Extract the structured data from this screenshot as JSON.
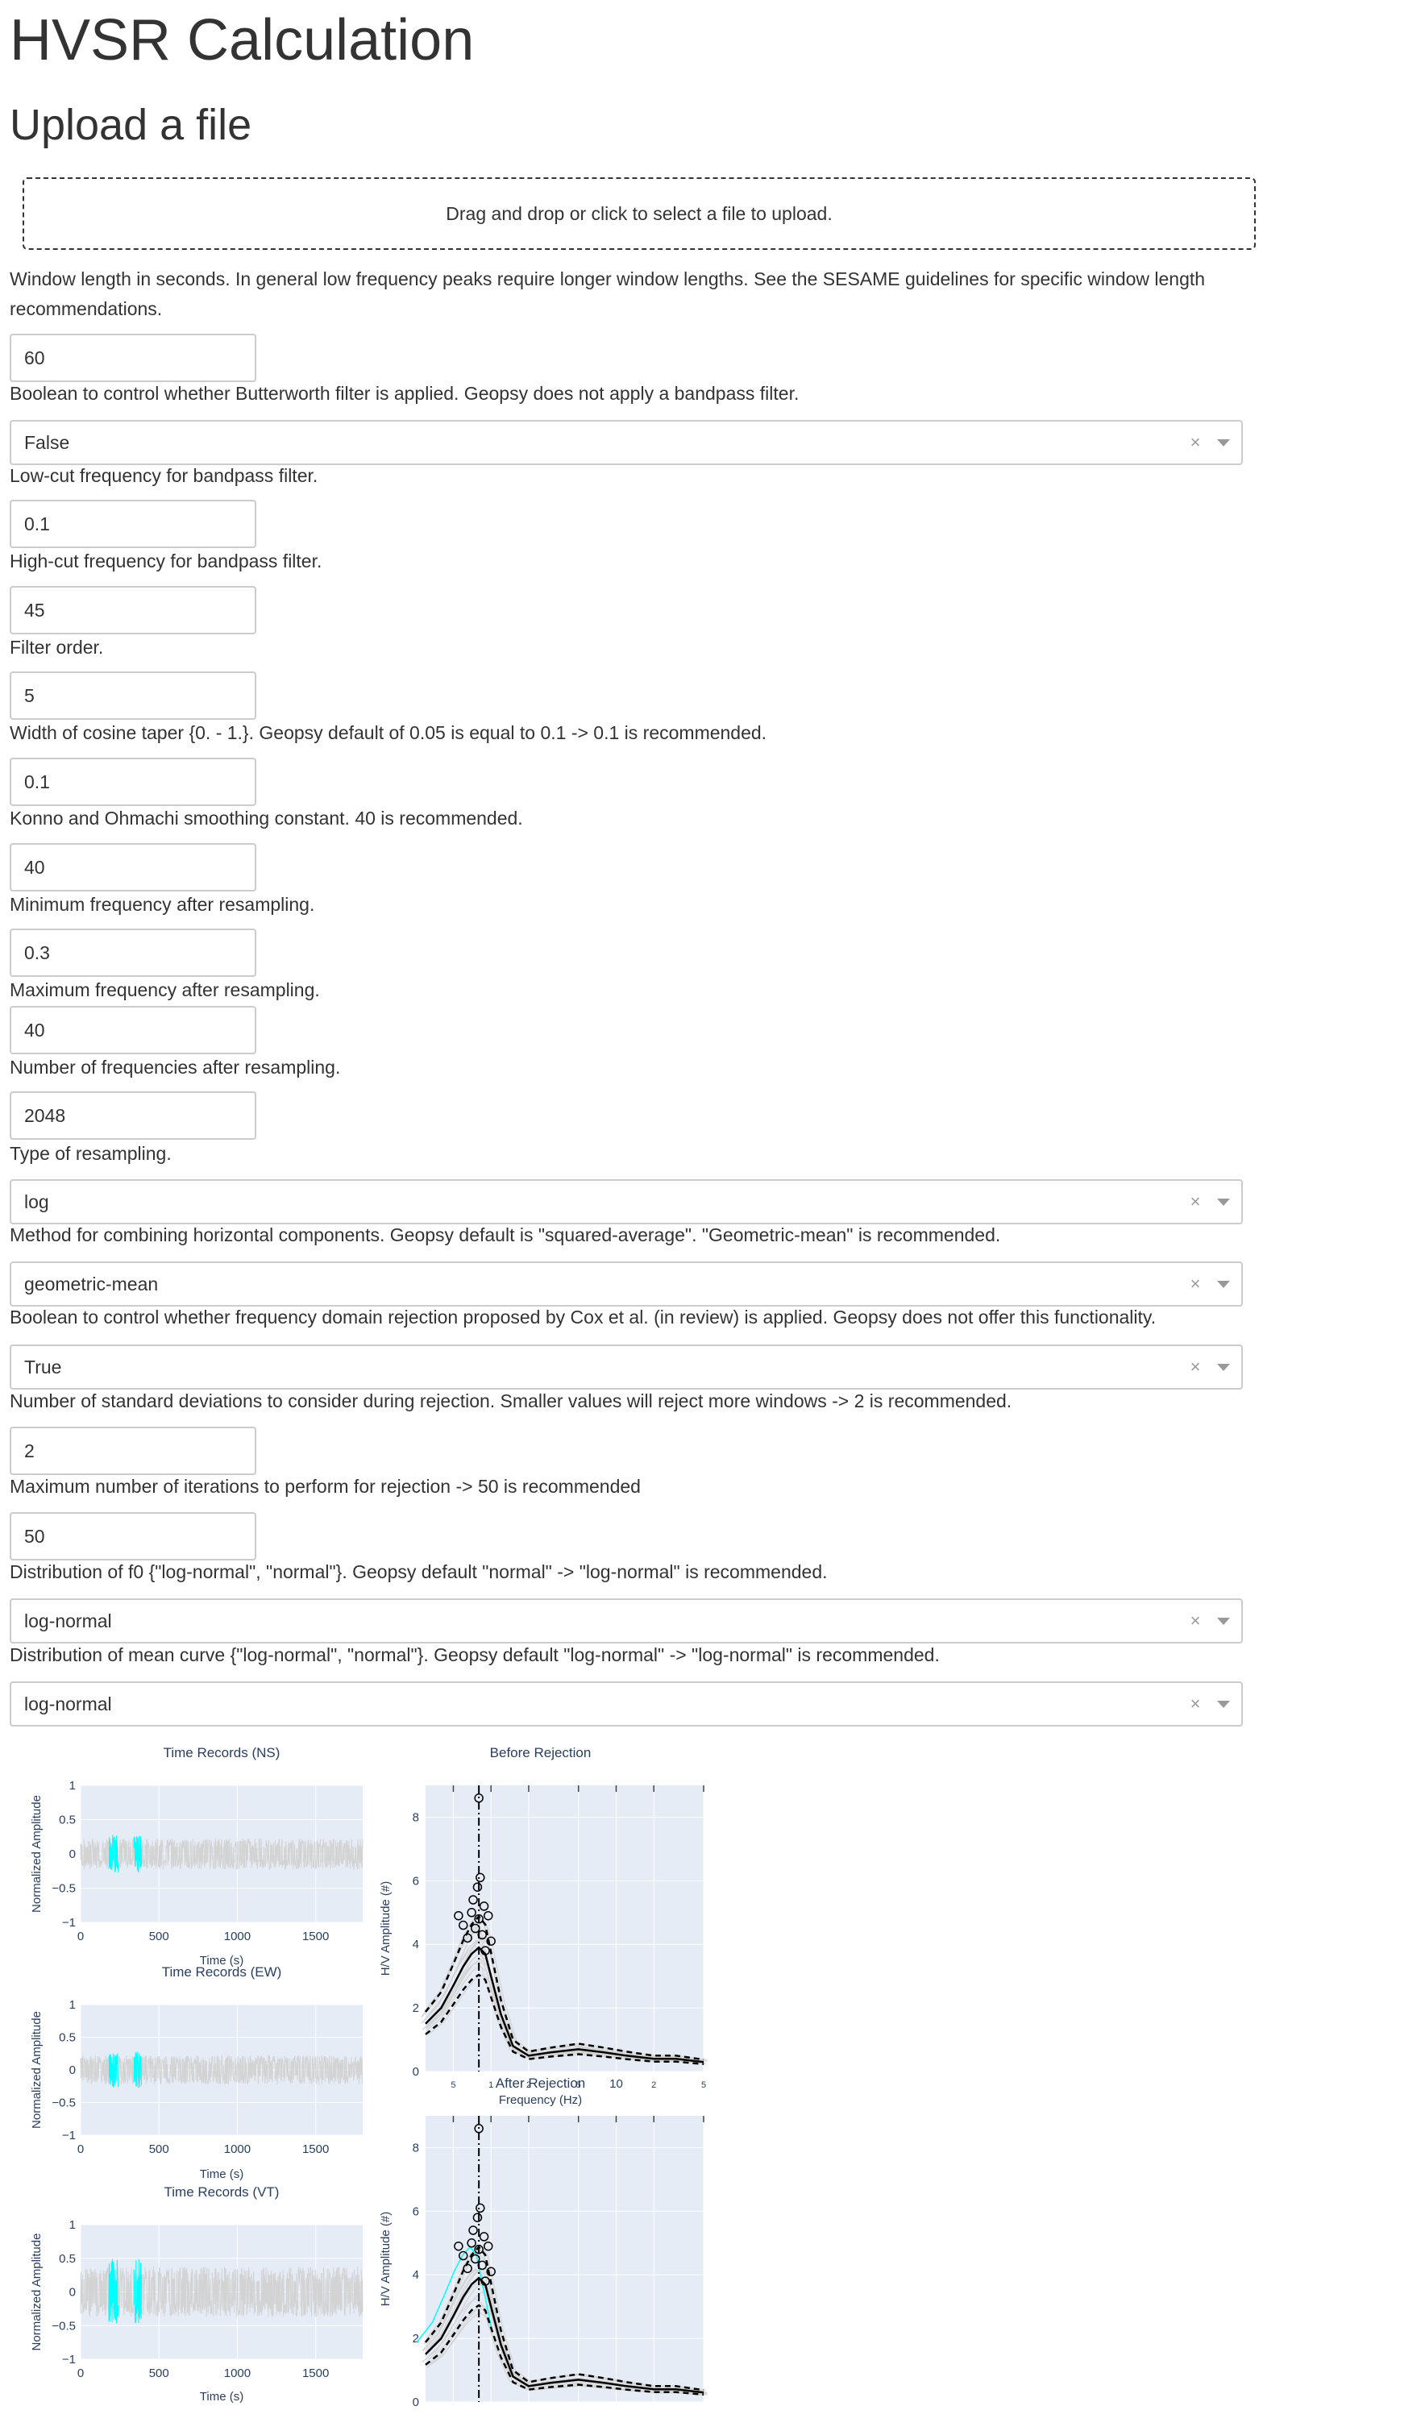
{
  "page": {
    "title": "HVSR Calculation",
    "upload_heading": "Upload a file",
    "upload_text": "Drag and drop or click to select a file to upload."
  },
  "params": [
    {
      "label": "Window length in seconds. In general low frequency peaks require longer window lengths. See the SESAME guidelines for specific window length recommendations.",
      "type": "input",
      "value": "60"
    },
    {
      "label": "Boolean to control whether Butterworth filter is applied. Geopsy does not apply a bandpass filter.",
      "type": "select",
      "value": "False"
    },
    {
      "label": "Low-cut frequency for bandpass filter.",
      "type": "input",
      "value": "0.1"
    },
    {
      "label": "High-cut frequency for bandpass filter.",
      "type": "input",
      "value": "45"
    },
    {
      "label": "Filter order.",
      "type": "input",
      "value": "5"
    },
    {
      "label": "Width of cosine taper {0. - 1.}. Geopsy default of 0.05 is equal to 0.1 -> 0.1 is recommended.",
      "type": "input",
      "value": "0.1"
    },
    {
      "label": "Konno and Ohmachi smoothing constant. 40 is recommended.",
      "type": "input",
      "value": "40"
    },
    {
      "label": "Minimum frequency after resampling.",
      "type": "input",
      "value": "0.3"
    },
    {
      "label": "Maximum frequency after resampling.",
      "type": "input",
      "value": "40"
    },
    {
      "label": "Number of frequencies after resampling.",
      "type": "input",
      "value": "2048"
    },
    {
      "label": "Type of resampling.",
      "type": "select",
      "value": "log"
    },
    {
      "label": "Method for combining horizontal components. Geopsy default is \"squared-average\". \"Geometric-mean\" is recommended.",
      "type": "select",
      "value": "geometric-mean"
    },
    {
      "label": "Boolean to control whether frequency domain rejection proposed by Cox et al. (in review) is applied. Geopsy does not offer this functionality.",
      "type": "select",
      "value": "True"
    },
    {
      "label": "Number of standard deviations to consider during rejection. Smaller values will reject more windows -> 2 is recommended.",
      "type": "input",
      "value": "2"
    },
    {
      "label": "Maximum number of iterations to perform for rejection -> 50 is recommended",
      "type": "input",
      "value": "50"
    },
    {
      "label": "Distribution of f0 {\"log-normal\", \"normal\"}. Geopsy default \"normal\" -> \"log-normal\" is recommended.",
      "type": "select",
      "value": "log-normal"
    },
    {
      "label": "Distribution of mean curve {\"log-normal\", \"normal\"}. Geopsy default \"log-normal\" -> \"log-normal\" is recommended.",
      "type": "select",
      "value": "log-normal"
    }
  ],
  "colors": {
    "plot_bg": "#e5ecf6",
    "trace_gray": "#d3d3d3",
    "rejected_cyan": "#00ffff",
    "text": "#333333"
  },
  "chart_data": [
    {
      "type": "line",
      "title": "Time Records (NS)",
      "xlabel": "Time (s)",
      "ylabel": "Normalized Amplitude",
      "xlim": [
        0,
        1800
      ],
      "ylim": [
        -1,
        1
      ],
      "xticks": [
        "0",
        "500",
        "1000",
        "1500"
      ],
      "yticks": [
        "1",
        "0.5",
        "0",
        "−0.5",
        "−1"
      ],
      "series": [
        {
          "color": "#d3d3d3",
          "x": [
            0,
            1800
          ],
          "amplitude": 0.15
        },
        {
          "color": "#00ffff",
          "x_ranges": [
            [
              180,
              240
            ],
            [
              340,
              390
            ]
          ],
          "amplitude": 0.2
        }
      ]
    },
    {
      "type": "line",
      "title": "Time Records (EW)",
      "xlabel": "Time (s)",
      "ylabel": "Normalized Amplitude",
      "xlim": [
        0,
        1800
      ],
      "ylim": [
        -1,
        1
      ],
      "xticks": [
        "0",
        "500",
        "1000",
        "1500"
      ],
      "yticks": [
        "1",
        "0.5",
        "0",
        "−0.5",
        "−1"
      ],
      "series": [
        {
          "color": "#d3d3d3",
          "x": [
            0,
            1800
          ],
          "amplitude": 0.15
        },
        {
          "color": "#00ffff",
          "x_ranges": [
            [
              180,
              240
            ],
            [
              340,
              390
            ]
          ],
          "amplitude": 0.2
        }
      ]
    },
    {
      "type": "line",
      "title": "Time Records (VT)",
      "xlabel": "Time (s)",
      "ylabel": "Normalized Amplitude",
      "xlim": [
        0,
        1800
      ],
      "ylim": [
        -1,
        1
      ],
      "xticks": [
        "0",
        "500",
        "1000",
        "1500"
      ],
      "yticks": [
        "1",
        "0.5",
        "0",
        "−0.5",
        "−1"
      ],
      "series": [
        {
          "color": "#d3d3d3",
          "x": [
            0,
            1800
          ],
          "amplitude": 0.25
        },
        {
          "color": "#00ffff",
          "x_ranges": [
            [
              180,
              240
            ],
            [
              340,
              390
            ]
          ],
          "amplitude": 0.35
        }
      ]
    },
    {
      "type": "line",
      "title": "Before Rejection",
      "xlabel": "Frequency (Hz)",
      "ylabel": "H/V Amplitude (#)",
      "xscale": "log",
      "xlim": [
        0.3,
        50
      ],
      "ylim": [
        0,
        9
      ],
      "xticks": [
        "5",
        "1",
        "2",
        "5",
        "10",
        "2",
        "5"
      ],
      "yticks": [
        "0",
        "2",
        "4",
        "6",
        "8"
      ],
      "f0_line": 0.8,
      "mean_curve": {
        "x": [
          0.3,
          0.4,
          0.5,
          0.6,
          0.7,
          0.8,
          0.9,
          1.0,
          1.2,
          1.5,
          2,
          3,
          5,
          8,
          12,
          20,
          30,
          50
        ],
        "y": [
          1.5,
          2.0,
          2.7,
          3.3,
          3.7,
          3.9,
          3.7,
          3.0,
          1.8,
          0.8,
          0.5,
          0.6,
          0.7,
          0.6,
          0.5,
          0.4,
          0.4,
          0.3
        ]
      },
      "f0_points": {
        "x": [
          0.55,
          0.6,
          0.65,
          0.7,
          0.72,
          0.75,
          0.78,
          0.8,
          0.82,
          0.85,
          0.88,
          0.9,
          0.95,
          1.0,
          0.8
        ],
        "y": [
          4.9,
          4.6,
          4.2,
          5.0,
          5.4,
          4.5,
          5.8,
          4.8,
          6.1,
          4.3,
          5.2,
          3.8,
          4.9,
          4.1,
          8.6
        ]
      }
    },
    {
      "type": "line",
      "title": "After Rejection",
      "xlabel": "Frequency (Hz)",
      "ylabel": "H/V Amplitude (#)",
      "xscale": "log",
      "xlim": [
        0.3,
        50
      ],
      "ylim": [
        0,
        9
      ],
      "xticks": [
        "5",
        "1",
        "2",
        "5",
        "10",
        "2",
        "5"
      ],
      "yticks": [
        "0",
        "2",
        "4",
        "6",
        "8"
      ],
      "f0_line": 0.8,
      "mean_curve": {
        "x": [
          0.3,
          0.4,
          0.5,
          0.6,
          0.7,
          0.8,
          0.9,
          1.0,
          1.2,
          1.5,
          2,
          3,
          5,
          8,
          12,
          20,
          30,
          50
        ],
        "y": [
          1.5,
          2.0,
          2.7,
          3.3,
          3.7,
          3.9,
          3.7,
          3.0,
          1.8,
          0.8,
          0.5,
          0.6,
          0.7,
          0.6,
          0.5,
          0.4,
          0.4,
          0.3
        ]
      },
      "f0_points": {
        "x": [
          0.55,
          0.6,
          0.65,
          0.7,
          0.72,
          0.75,
          0.78,
          0.8,
          0.82,
          0.85,
          0.88,
          0.9,
          0.95,
          1.0,
          0.8
        ],
        "y": [
          4.9,
          4.6,
          4.2,
          5.0,
          5.4,
          4.5,
          5.8,
          4.8,
          6.1,
          4.3,
          5.2,
          3.8,
          4.9,
          4.1,
          8.6
        ]
      }
    }
  ]
}
